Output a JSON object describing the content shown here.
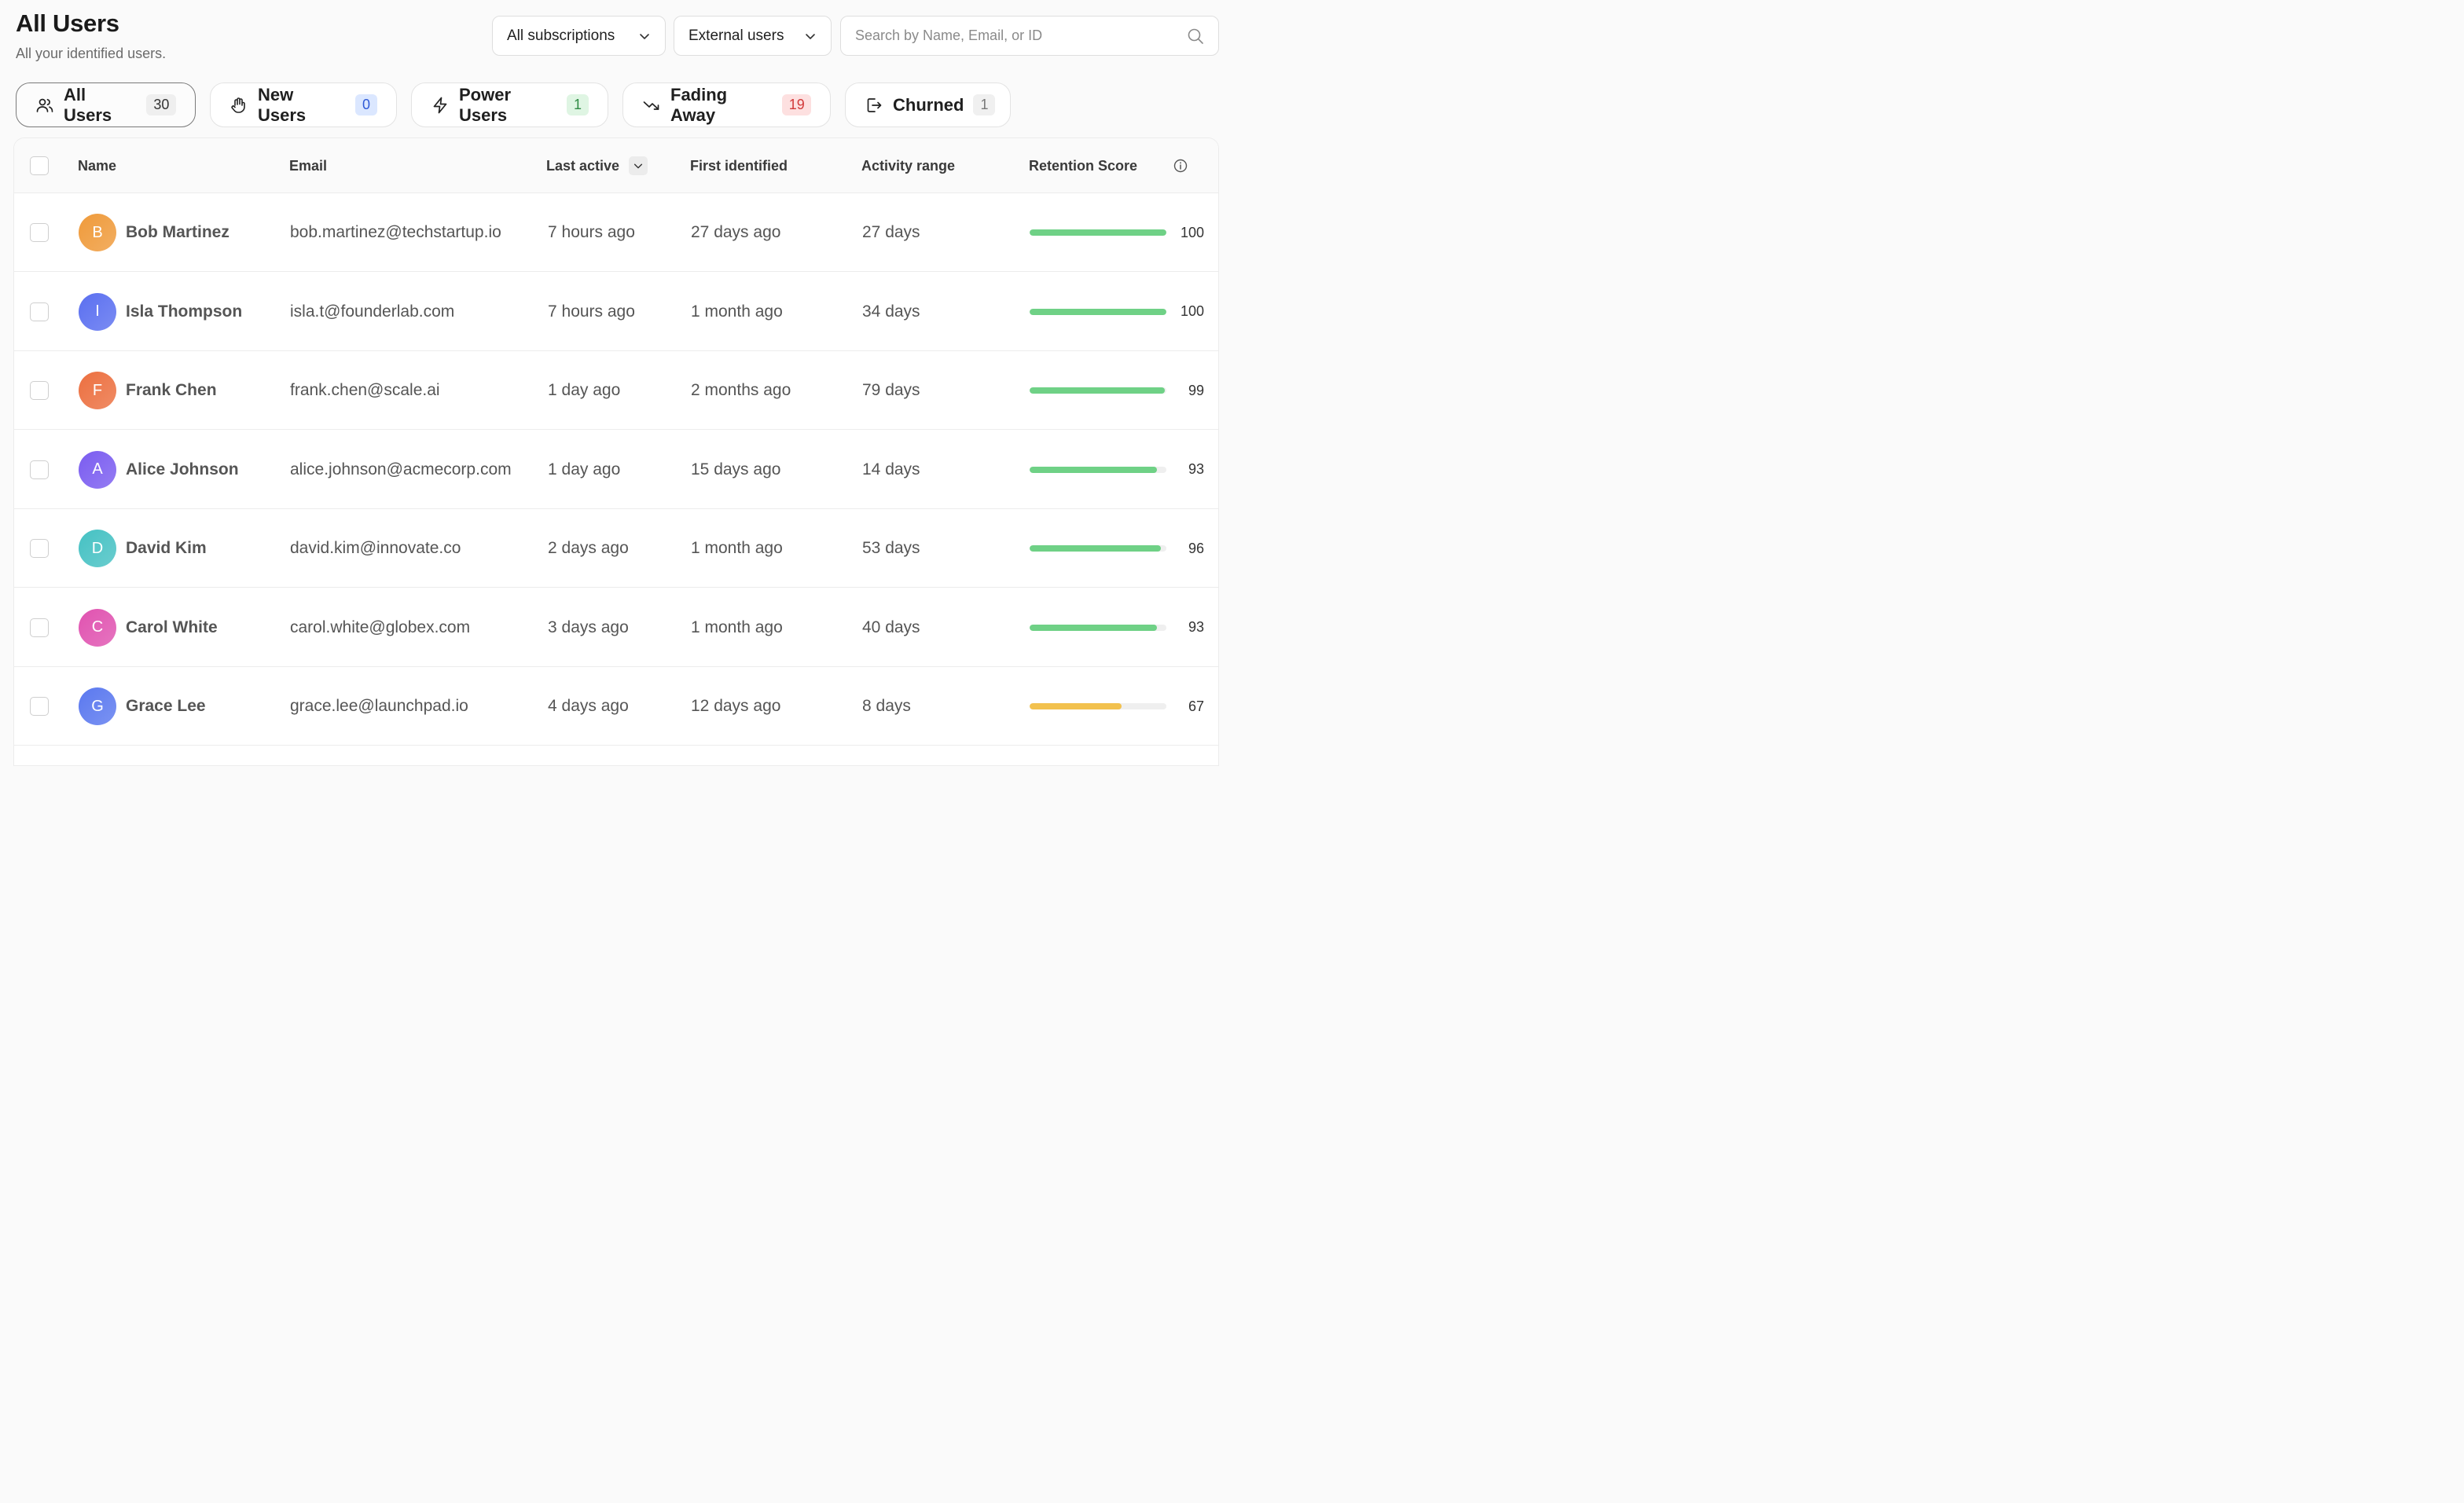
{
  "header": {
    "title": "All Users",
    "subtitle": "All your identified users."
  },
  "filters": {
    "subscriptions": "All subscriptions",
    "user_type": "External users",
    "search_placeholder": "Search by Name, Email, or ID"
  },
  "tabs": [
    {
      "label": "All Users",
      "count": "30",
      "icon": "users-icon",
      "badge": "gray",
      "active": true
    },
    {
      "label": "New Users",
      "count": "0",
      "icon": "wave-hand-icon",
      "badge": "blue",
      "active": false
    },
    {
      "label": "Power Users",
      "count": "1",
      "icon": "lightning-icon",
      "badge": "green",
      "active": false
    },
    {
      "label": "Fading Away",
      "count": "19",
      "icon": "trending-down-icon",
      "badge": "red",
      "active": false
    },
    {
      "label": "Churned",
      "count": "1",
      "icon": "logout-icon",
      "badge": "lightgray",
      "active": false
    }
  ],
  "columns": {
    "name": "Name",
    "email": "Email",
    "last_active": "Last active",
    "first_identified": "First identified",
    "activity_range": "Activity range",
    "retention_score": "Retention Score"
  },
  "colors": {
    "score_high": "#6fd186",
    "score_mid": "#f2c14e"
  },
  "rows": [
    {
      "initial": "B",
      "name": "Bob Martinez",
      "email": "bob.martinez@techstartup.io",
      "last_active": "7 hours ago",
      "first_identified": "27 days ago",
      "activity_range": "27 days",
      "score": "100",
      "avatar_color": "#ef9a3a"
    },
    {
      "initial": "I",
      "name": "Isla Thompson",
      "email": "isla.t@founderlab.com",
      "last_active": "7 hours ago",
      "first_identified": "1 month ago",
      "activity_range": "34 days",
      "score": "100",
      "avatar_color": "#5a6ff0"
    },
    {
      "initial": "F",
      "name": "Frank Chen",
      "email": "frank.chen@scale.ai",
      "last_active": "1 day ago",
      "first_identified": "2 months ago",
      "activity_range": "79 days",
      "score": "99",
      "avatar_color": "#ec6f3f"
    },
    {
      "initial": "A",
      "name": "Alice Johnson",
      "email": "alice.johnson@acmecorp.com",
      "last_active": "1 day ago",
      "first_identified": "15 days ago",
      "activity_range": "14 days",
      "score": "93",
      "avatar_color": "#7a5cf0"
    },
    {
      "initial": "D",
      "name": "David Kim",
      "email": "david.kim@innovate.co",
      "last_active": "2 days ago",
      "first_identified": "1 month ago",
      "activity_range": "53 days",
      "score": "96",
      "avatar_color": "#45c1c3"
    },
    {
      "initial": "C",
      "name": "Carol White",
      "email": "carol.white@globex.com",
      "last_active": "3 days ago",
      "first_identified": "1 month ago",
      "activity_range": "40 days",
      "score": "93",
      "avatar_color": "#e052b0"
    },
    {
      "initial": "G",
      "name": "Grace Lee",
      "email": "grace.lee@launchpad.io",
      "last_active": "4 days ago",
      "first_identified": "12 days ago",
      "activity_range": "8 days",
      "score": "67",
      "avatar_color": "#5a78ef"
    }
  ]
}
